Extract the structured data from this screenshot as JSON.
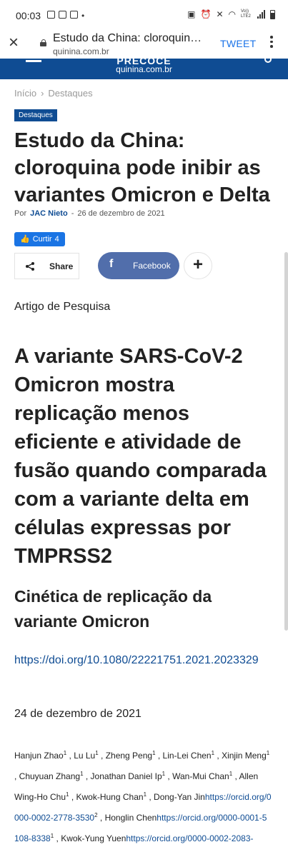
{
  "status_bar": {
    "time": "00:03",
    "network": "Vo)) LTE2"
  },
  "toolbar": {
    "page_title": "Estudo da China: cloroquina pode inibir as variantes Omicron e Delta",
    "url": "quinina.com.br",
    "tweet_label": "TWEET"
  },
  "site_header": {
    "logo_text": "PRECOCE",
    "logo_sub": "quinina.com.br"
  },
  "breadcrumb": {
    "home": "Início",
    "separator": "›",
    "section": "Destaques"
  },
  "tag": "Destaques",
  "article": {
    "title": "Estudo da China: cloroquina pode inibir as variantes Omicron e Delta",
    "by_prefix": "Por",
    "author": "JAC Nieto",
    "separator": "-",
    "date": "26 de dezembro de 2021",
    "like_label": "Curtir",
    "like_count": "4",
    "share_label": "Share",
    "facebook_label": "Facebook",
    "type": "Artigo de Pesquisa",
    "headline": "A variante SARS-CoV-2 Omicron mostra replicação menos eficiente e atividade de fusão quando comparada com a variante delta em células expressas por TMPRSS2",
    "subheading": "Cinética de replicação da variante Omicron",
    "doi": "https://doi.org/10.1080/22221751.2021.2023329",
    "published": "24 de dezembro de 2021"
  },
  "authors": [
    {
      "name": "Hanjun Zhao",
      "sup": "1",
      "link": ""
    },
    {
      "name": "Lu Lu",
      "sup": "1",
      "link": ""
    },
    {
      "name": "Zheng Peng",
      "sup": "1",
      "link": ""
    },
    {
      "name": "Lin-Lei Chen",
      "sup": "1",
      "link": ""
    },
    {
      "name": "Xinjin Meng",
      "sup": "1",
      "link": ""
    },
    {
      "name": "Chuyuan Zhang",
      "sup": "1",
      "link": ""
    },
    {
      "name": "Jonathan Daniel Ip",
      "sup": "1",
      "link": ""
    },
    {
      "name": "Wan-Mui Chan",
      "sup": "1",
      "link": ""
    },
    {
      "name": "Allen Wing-Ho Chu",
      "sup": "1",
      "link": ""
    },
    {
      "name": "Kwok-Hung Chan",
      "sup": "1",
      "link": ""
    },
    {
      "name": "Dong-Yan Jin",
      "sup": "",
      "link": "https://orcid.org/0000-0002-2778-3530",
      "sup2": "2"
    },
    {
      "name": "Honglin Chen",
      "sup": "",
      "link": "https://orcid.org/0000-0001-5108-8338",
      "sup2": "1"
    },
    {
      "name": "Kwok-Yung Yuen",
      "sup": "",
      "link": "https://orcid.org/0000-0002-2083-",
      "sup2": ""
    }
  ]
}
